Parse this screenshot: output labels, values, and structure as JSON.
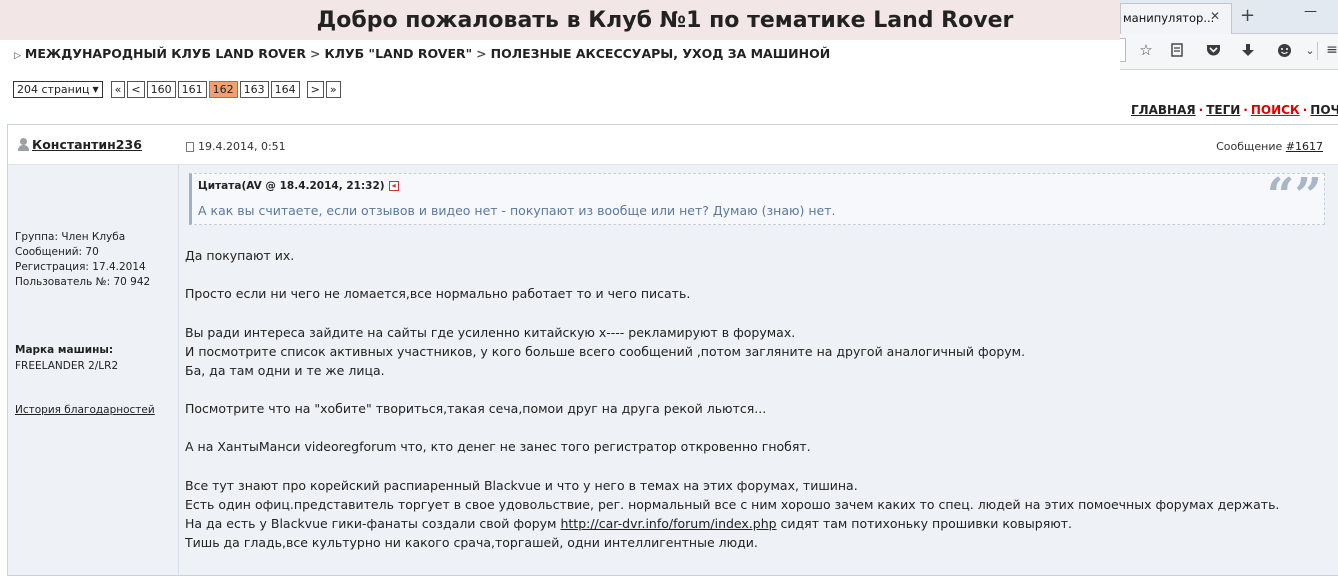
{
  "banner": {
    "title": "Добро пожаловать в Клуб №1 по тематике Land Rover"
  },
  "browser": {
    "tab_label": "манипулятор...",
    "tab_close": "✕",
    "new_tab": "+",
    "window_control": "—",
    "toolbar_icons": [
      "star-icon",
      "reader-icon",
      "pocket-icon",
      "download-icon",
      "emoji-icon",
      "chevron-down-icon"
    ]
  },
  "breadcrumb": {
    "items": [
      "МЕЖДУНАРОДНЫЙ КЛУБ LAND ROVER",
      "КЛУБ \"LAND ROVER\"",
      "ПОЛЕЗНЫЕ АКСЕССУАРЫ, УХОД ЗА МАШИНОЙ"
    ],
    "separator": ">"
  },
  "pager": {
    "select_label": "204 страниц",
    "first": "«",
    "prev": "<",
    "pages": [
      "160",
      "161",
      "162",
      "163",
      "164"
    ],
    "current": "162",
    "next": ">",
    "last": "»"
  },
  "sitenav": {
    "home": "ГЛАВНАЯ",
    "tags": "ТЕГИ",
    "search": "ПОИСК",
    "mail": "ПОЧТА"
  },
  "post": {
    "author": "Константин236",
    "date": "19.4.2014, 0:51",
    "msg_prefix": "Сообщение",
    "msg_link": "#1617",
    "group": "Группа: Член Клуба",
    "messages": "Сообщений: 70",
    "registered": "Регистрация: 17.4.2014",
    "user_no": "Пользователь №: 70 942",
    "car_label": "Марка машины:",
    "car_value": "FREELANDER 2/LR2",
    "thanks_link": "История благодарностей",
    "quote_head": "Цитата(AV @ 18.4.2014, 21:32)",
    "quote_text": "А как вы считаете, если отзывов и видео нет - покупают из вообще или нет? Думаю (знаю) нет.",
    "lines": [
      "Да покупают их.",
      "Просто если ни чего не ломается,все нормально работает то и чего писать.",
      "Вы ради интереса зайдите на сайты где усиленно китайскую х---- рекламируют в форумах.",
      "И посмотрите список активных участников, у кого больше всего сообщений ,потом загляните на другой аналогичный форум.",
      "Ба, да там одни и те же лица.",
      "Посмотрите что на \"хобите\" твориться,такая сеча,помои друг на друга рекой льются...",
      "А на ХантыМанси videoregforum что, кто денег не занес того регистратор откровенно гнобят.",
      "Все тут знают про корейский распиаренный Blackvue и что у него в темах на этих форумах, тишина.",
      "Есть один офиц.представитель торгует в свое удовольствие, рег. нормальный все с ним хорошо зачем каких то спец. людей на этих помоечных форумах держать."
    ],
    "line_link_prefix": "На да есть у Blackvue гики-фанаты создали свой форум ",
    "line_link_url": "http://car-dvr.info/forum/index.php",
    "line_link_suffix": " сидят там потихоньку прошивки ковыряют.",
    "last_line": "Тишь да гладь,все культурно ни какого срача,торгашей, одни интеллигентные люди."
  }
}
